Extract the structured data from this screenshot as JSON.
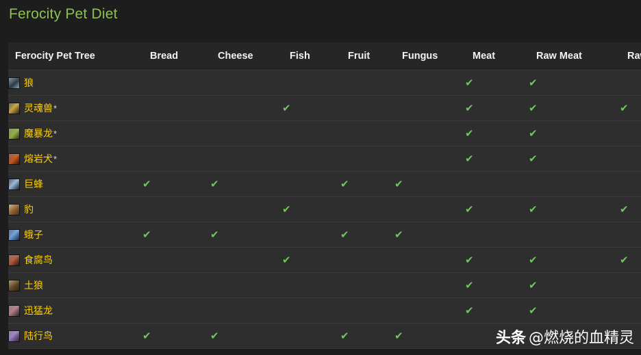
{
  "page": {
    "title": "Ferocity Pet Diet",
    "title_color": "#8cc152",
    "background": "#1d1d1d"
  },
  "watermark": {
    "brand": "头条",
    "handle": "@燃烧的血精灵"
  },
  "colors": {
    "pet_name": "#ffd100",
    "check": "#6dc95c",
    "header_text": "#f2f2f2",
    "row_bg": "#2e2e2e",
    "header_bg": "#262626",
    "row_divider": "#3a3a3a"
  },
  "table": {
    "columns": [
      {
        "key": "pet",
        "label": "Ferocity Pet Tree"
      },
      {
        "key": "bread",
        "label": "Bread"
      },
      {
        "key": "cheese",
        "label": "Cheese"
      },
      {
        "key": "fish",
        "label": "Fish"
      },
      {
        "key": "fruit",
        "label": "Fruit"
      },
      {
        "key": "fungus",
        "label": "Fungus"
      },
      {
        "key": "meat",
        "label": "Meat"
      },
      {
        "key": "rawmeat",
        "label": "Raw Meat"
      },
      {
        "key": "rawfish",
        "label": "Raw Fish"
      }
    ],
    "check_glyph": "✔",
    "rows": [
      {
        "name": "狼",
        "star": "",
        "icon": "wolf-icon",
        "icon_class": "ic-wolf",
        "diet": [
          false,
          false,
          false,
          false,
          false,
          true,
          true,
          false
        ]
      },
      {
        "name": "灵魂兽",
        "star": "*",
        "icon": "spirit-beast-icon",
        "icon_class": "ic-spirit",
        "diet": [
          false,
          false,
          true,
          false,
          false,
          true,
          true,
          true
        ]
      },
      {
        "name": "魔暴龙",
        "star": "*",
        "icon": "devilsaur-icon",
        "icon_class": "ic-devilsaur",
        "diet": [
          false,
          false,
          false,
          false,
          false,
          true,
          true,
          false
        ]
      },
      {
        "name": "熔岩犬",
        "star": "*",
        "icon": "core-hound-icon",
        "icon_class": "ic-coredog",
        "diet": [
          false,
          false,
          false,
          false,
          false,
          true,
          true,
          false
        ]
      },
      {
        "name": "巨蜂",
        "star": "",
        "icon": "wasp-icon",
        "icon_class": "ic-wasp",
        "diet": [
          true,
          true,
          false,
          true,
          true,
          false,
          false,
          false
        ]
      },
      {
        "name": "豹",
        "star": "",
        "icon": "cat-icon",
        "icon_class": "ic-cat",
        "diet": [
          false,
          false,
          true,
          false,
          false,
          true,
          true,
          true
        ]
      },
      {
        "name": "蛾子",
        "star": "",
        "icon": "moth-icon",
        "icon_class": "ic-moth",
        "diet": [
          true,
          true,
          false,
          true,
          true,
          false,
          false,
          false
        ]
      },
      {
        "name": "食腐鸟",
        "star": "",
        "icon": "carrion-bird-icon",
        "icon_class": "ic-carrion",
        "diet": [
          false,
          false,
          true,
          false,
          false,
          true,
          true,
          true
        ]
      },
      {
        "name": "土狼",
        "star": "",
        "icon": "hyena-icon",
        "icon_class": "ic-hyena",
        "diet": [
          false,
          false,
          false,
          false,
          false,
          true,
          true,
          false
        ]
      },
      {
        "name": "迅猛龙",
        "star": "",
        "icon": "raptor-icon",
        "icon_class": "ic-raptor",
        "diet": [
          false,
          false,
          false,
          false,
          false,
          true,
          true,
          false
        ]
      },
      {
        "name": "陆行鸟",
        "star": "",
        "icon": "tallstrider-icon",
        "icon_class": "ic-tallstr",
        "diet": [
          true,
          true,
          false,
          true,
          true,
          false,
          false,
          false
        ]
      }
    ]
  }
}
